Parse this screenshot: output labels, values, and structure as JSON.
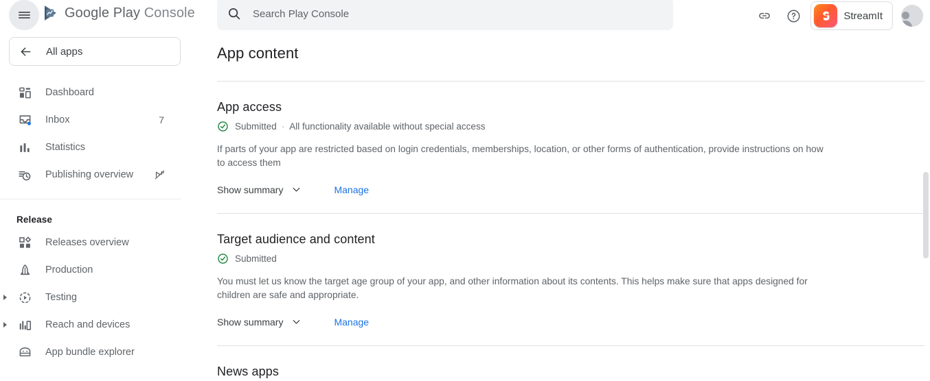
{
  "brand": {
    "name_primary": "Google Play",
    "name_secondary": "Console",
    "logo_icon": "play-console-logo"
  },
  "topbar": {
    "menu_icon": "hamburger-menu-icon",
    "search": {
      "icon": "search-icon",
      "placeholder": "Search Play Console",
      "value": ""
    },
    "link_icon": "link-icon",
    "help_icon": "help-circle-icon",
    "app_chip": {
      "app_icon": "streamit-app-icon",
      "app_name": "StreamIt"
    },
    "avatar_icon": "account-avatar-icon"
  },
  "sidebar": {
    "all_apps": {
      "back_icon": "arrow-back-icon",
      "label": "All apps"
    },
    "items": [
      {
        "label": "Dashboard",
        "icon": "dashboard-icon",
        "badge": "",
        "expandable": false,
        "trailing_icon": ""
      },
      {
        "label": "Inbox",
        "icon": "inbox-icon",
        "badge": "7",
        "expandable": false,
        "trailing_icon": ""
      },
      {
        "label": "Statistics",
        "icon": "bar-chart-icon",
        "badge": "",
        "expandable": false,
        "trailing_icon": ""
      },
      {
        "label": "Publishing overview",
        "icon": "publishing-clock-icon",
        "badge": "",
        "expandable": false,
        "trailing_icon": "publishing-paused-icon"
      }
    ],
    "section_release": {
      "title": "Release",
      "items": [
        {
          "label": "Releases overview",
          "icon": "releases-overview-icon",
          "expandable": false
        },
        {
          "label": "Production",
          "icon": "production-rocket-icon",
          "expandable": false
        },
        {
          "label": "Testing",
          "icon": "testing-play-icon",
          "expandable": true
        },
        {
          "label": "Reach and devices",
          "icon": "reach-devices-icon",
          "expandable": true
        },
        {
          "label": "App bundle explorer",
          "icon": "app-bundle-explorer-icon",
          "expandable": false
        }
      ]
    }
  },
  "main": {
    "page_title": "App content",
    "cards": [
      {
        "title": "App access",
        "status_icon": "check-circle-icon",
        "status": "Submitted",
        "separator": "·",
        "status_detail": "All functionality available without special access",
        "description": "If parts of your app are restricted based on login credentials, memberships, location, or other forms of authentication, provide instructions on how to access them",
        "show_summary_label": "Show summary",
        "chevron_icon": "chevron-down-icon",
        "manage_label": "Manage"
      },
      {
        "title": "Target audience and content",
        "status_icon": "check-circle-icon",
        "status": "Submitted",
        "separator": "",
        "status_detail": "",
        "description": "You must let us know the target age group of your app, and other information about its contents. This helps make sure that apps designed for children are safe and appropriate.",
        "show_summary_label": "Show summary",
        "chevron_icon": "chevron-down-icon",
        "manage_label": "Manage"
      },
      {
        "title": "News apps",
        "status_icon": "",
        "status": "",
        "separator": "",
        "status_detail": "",
        "description": "",
        "show_summary_label": "",
        "chevron_icon": "",
        "manage_label": ""
      }
    ]
  },
  "colors": {
    "accent_link": "#1a73e8",
    "status_success": "#188038",
    "text_primary": "#202124",
    "text_secondary": "#5f6368",
    "search_bg": "#f1f3f4",
    "divider": "#e0e0e0"
  }
}
